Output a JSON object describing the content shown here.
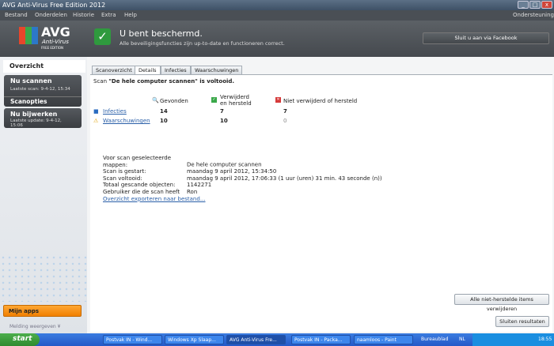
{
  "window": {
    "title": "AVG Anti-Virus Free Edition 2012",
    "minimize": "_",
    "maximize": "□",
    "close": "x"
  },
  "menu": {
    "items": [
      "Bestand",
      "Onderdelen",
      "Historie",
      "Extra",
      "Help"
    ],
    "support": "Ondersteuning"
  },
  "header": {
    "logo": "AVG",
    "logo_sub": "Anti-Virus",
    "logo_edition": "FREE EDITION",
    "status_title": "U bent beschermd.",
    "status_text": "Alle beveiligingsfuncties zijn up-to-date en functioneren correct.",
    "facebook_button": "Sluit u aan via Facebook"
  },
  "sidebar": {
    "overview": "Overzicht",
    "scan_now": "Nu scannen",
    "last_scan": "Laatste scan: 9-4-12, 15:34",
    "scan_options": "Scanopties",
    "update_now": "Nu bijwerken",
    "last_update": "Laatste update: 9-4-12, 15:06",
    "my_apps": "Mijn apps",
    "show_notification": "Melding weergeven ¥"
  },
  "tabs": [
    "Scanoverzicht",
    "Details",
    "Infecties",
    "Waarschuwingen"
  ],
  "scan": {
    "prefix": "Scan ",
    "name": "\"De hele computer scannen\"",
    "suffix": " is voltooid."
  },
  "results": {
    "headers": [
      "Gevonden",
      "Verwijderd en hersteld",
      "Niet verwijderd of hersteld"
    ],
    "rows": [
      {
        "label": "Infecties",
        "found": "14",
        "removed": "7",
        "not_removed": "7"
      },
      {
        "label": "Waarschuwingen",
        "found": "10",
        "removed": "10",
        "not_removed": "0"
      }
    ]
  },
  "details": [
    {
      "label": "Voor scan geselecteerde mappen:",
      "value": "De hele computer scannen"
    },
    {
      "label": "Scan is gestart:",
      "value": "maandag 9 april 2012, 15:34:50"
    },
    {
      "label": "Scan voltooid:",
      "value": "maandag 9 april 2012, 17:06:33 (1 uur (uren) 31 min. 43 seconde (n))"
    },
    {
      "label": "Totaal gescande objecten:",
      "value": "1142271"
    },
    {
      "label": "Gebruiker die de scan heeft",
      "value": "Ron"
    }
  ],
  "export_link": "Overzicht exporteren naar bestand...",
  "buttons": {
    "remove_all": "Alle niet-herstelde items verwijderen",
    "close_results": "Sluiten resultaten"
  },
  "taskbar": {
    "start": "start",
    "tasks": [
      "Postvak IN - Wind...",
      "Windows Xp Slaap...",
      "AVG Anti-Virus Fre...",
      "Postvak IN - Packa...",
      "naamloos - Paint"
    ],
    "desktop": "Bureaublad",
    "lang": "NL",
    "clock": "18:55"
  }
}
